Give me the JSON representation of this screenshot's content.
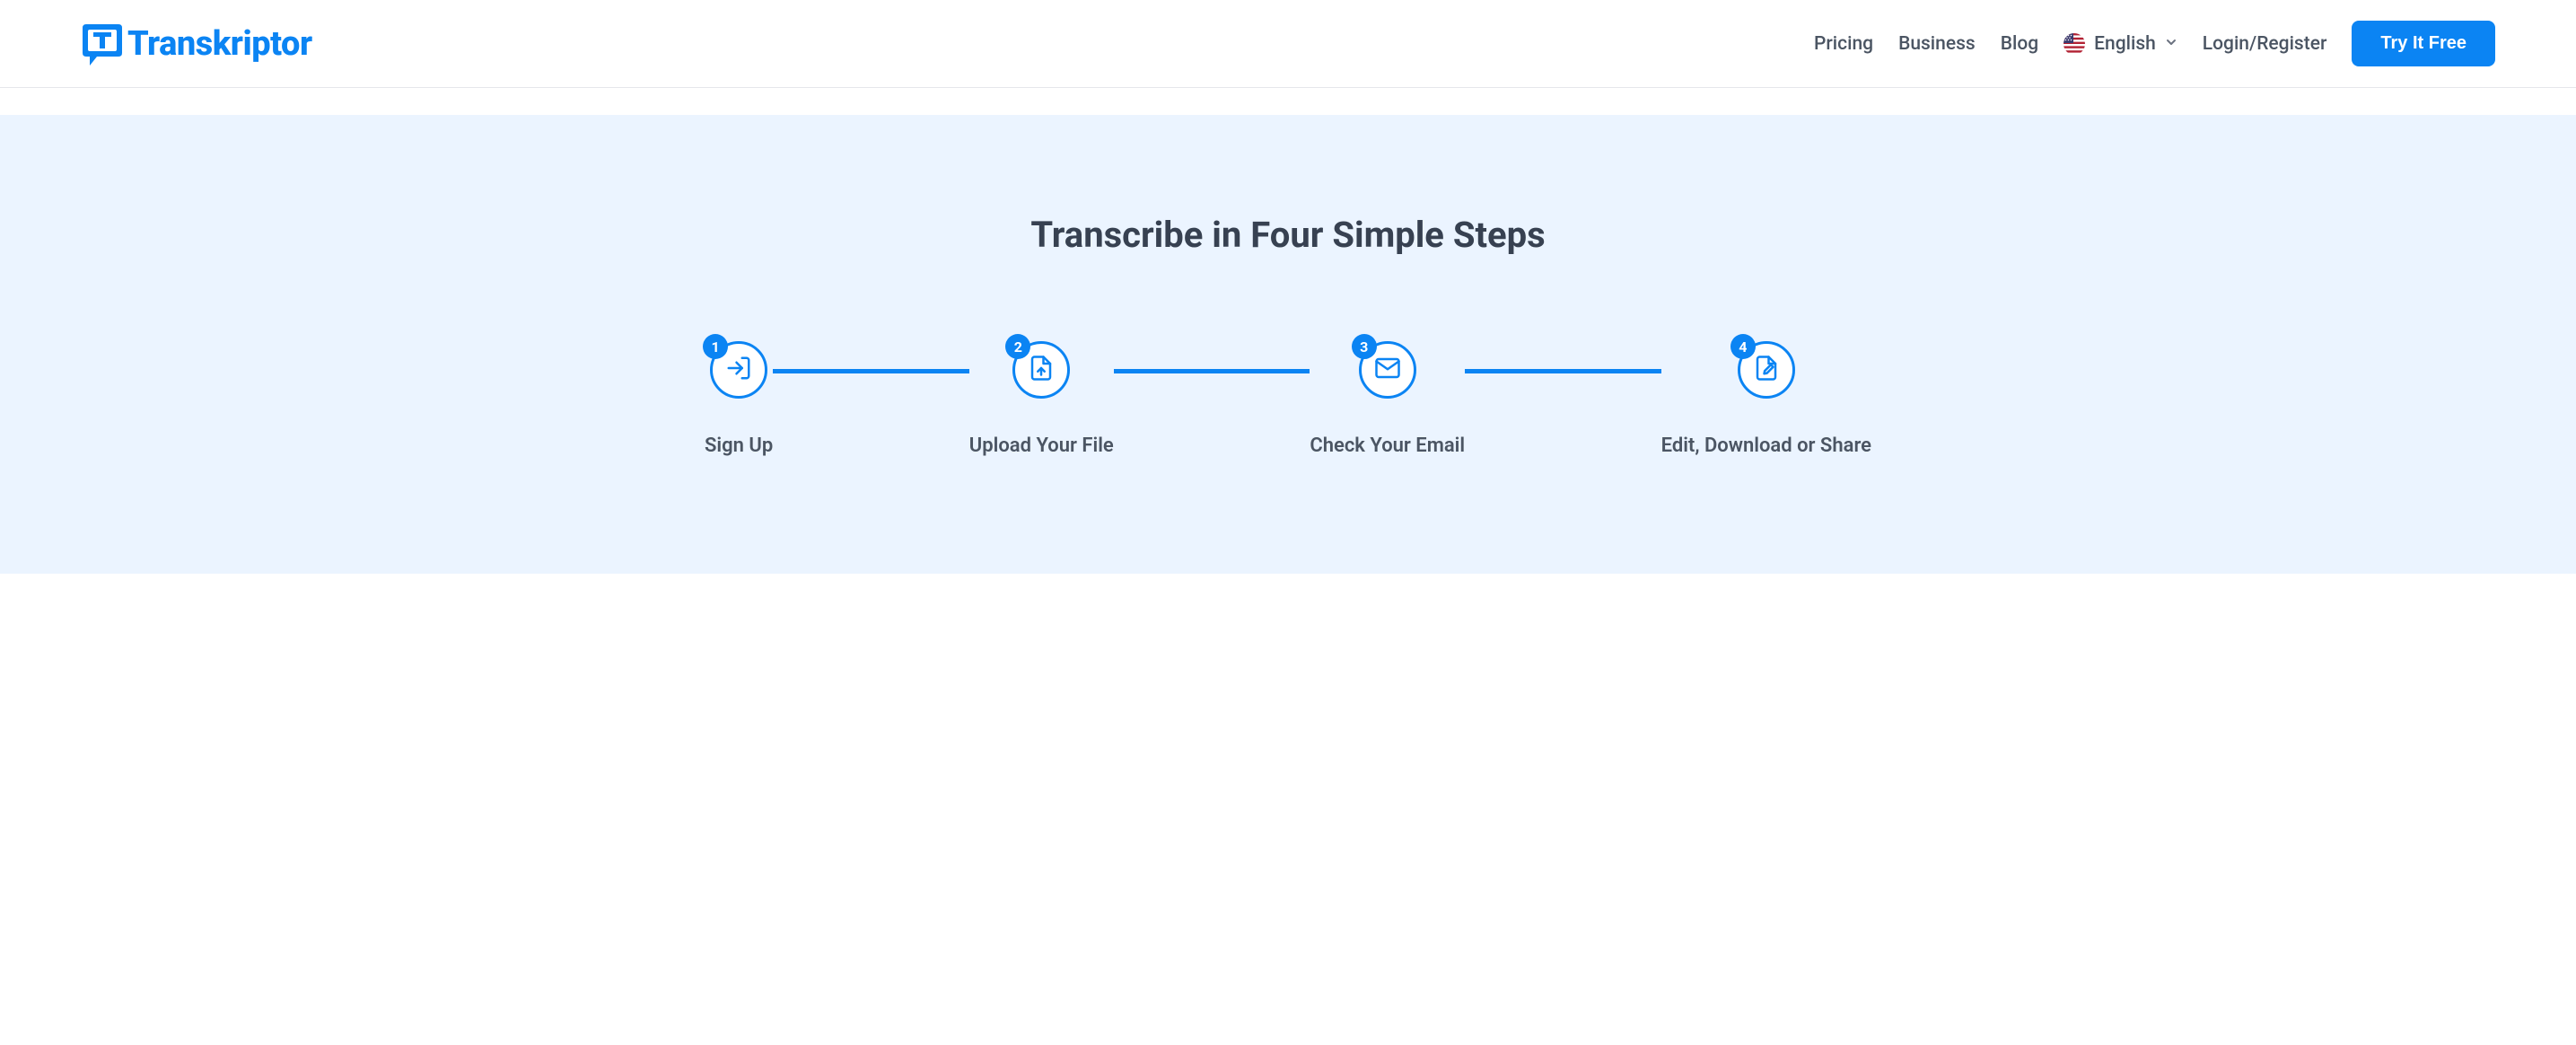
{
  "brand": {
    "name": "Transkriptor"
  },
  "nav": {
    "pricing": "Pricing",
    "business": "Business",
    "blog": "Blog",
    "language": "English",
    "login": "Login/Register"
  },
  "cta": {
    "label": "Try It Free"
  },
  "hero": {
    "title": "Transcribe in Four Simple Steps"
  },
  "steps": [
    {
      "number": "1",
      "label": "Sign Up"
    },
    {
      "number": "2",
      "label": "Upload Your File"
    },
    {
      "number": "3",
      "label": "Check Your Email"
    },
    {
      "number": "4",
      "label": "Edit, Download or Share"
    }
  ]
}
